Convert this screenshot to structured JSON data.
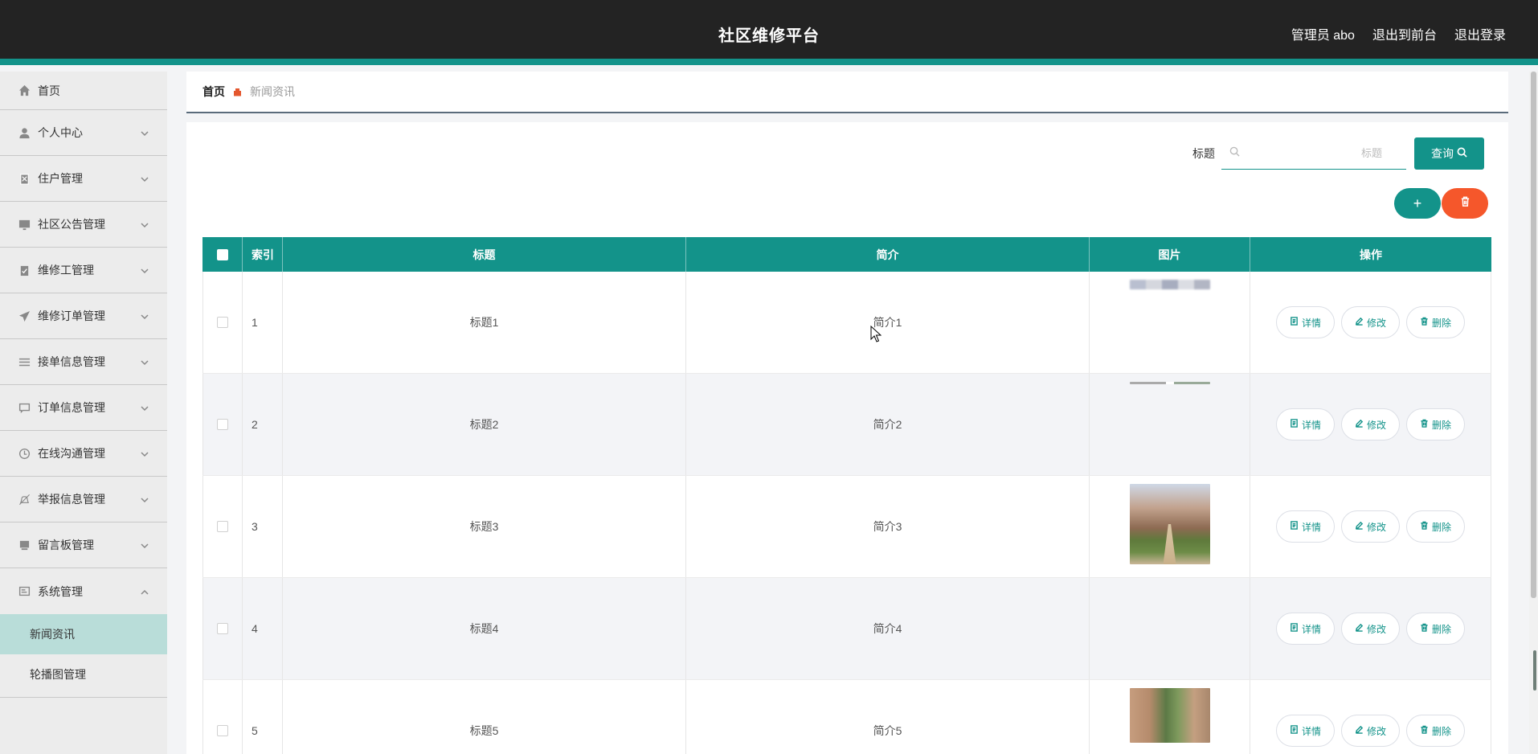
{
  "header": {
    "title": "社区维修平台",
    "nav": [
      "管理员 abo",
      "退出到前台",
      "退出登录"
    ]
  },
  "sidebar": {
    "items": [
      {
        "label": "首页",
        "icon": "home-icon"
      },
      {
        "label": "个人中心",
        "icon": "user-icon"
      },
      {
        "label": "住户管理",
        "icon": "clipboard-icon"
      },
      {
        "label": "社区公告管理",
        "icon": "monitor-icon"
      },
      {
        "label": "维修工管理",
        "icon": "clipboard-check-icon"
      },
      {
        "label": "维修订单管理",
        "icon": "send-icon"
      },
      {
        "label": "接单信息管理",
        "icon": "list-icon"
      },
      {
        "label": "订单信息管理",
        "icon": "chat-icon"
      },
      {
        "label": "在线沟通管理",
        "icon": "clock-icon"
      },
      {
        "label": "举报信息管理",
        "icon": "bell-off-icon"
      },
      {
        "label": "留言板管理",
        "icon": "message-board-icon"
      },
      {
        "label": "系统管理",
        "icon": "system-icon"
      }
    ],
    "subitems": [
      "新闻资讯",
      "轮播图管理"
    ]
  },
  "breadcrumb": {
    "home": "首页",
    "current": "新闻资讯"
  },
  "search": {
    "label": "标题",
    "placeholder": "标题",
    "value": "",
    "button": "查询"
  },
  "table": {
    "headers": [
      "索引",
      "标题",
      "简介",
      "图片",
      "操作"
    ],
    "rows": [
      {
        "index": "1",
        "title": "标题1",
        "intro": "简介1"
      },
      {
        "index": "2",
        "title": "标题2",
        "intro": "简介2"
      },
      {
        "index": "3",
        "title": "标题3",
        "intro": "简介3"
      },
      {
        "index": "4",
        "title": "标题4",
        "intro": "简介4"
      },
      {
        "index": "5",
        "title": "标题5",
        "intro": "简介5"
      }
    ],
    "actions": {
      "detail": "详情",
      "edit": "修改",
      "delete": "删除"
    }
  },
  "colors": {
    "accent": "#13938a",
    "danger": "#f5572b",
    "header_bg": "#232323"
  }
}
